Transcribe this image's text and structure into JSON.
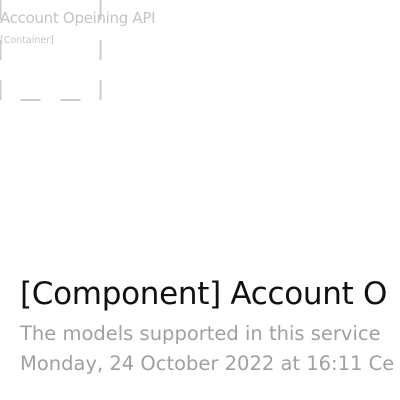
{
  "boundary": {
    "name": "Account Opeining API",
    "type": "[Container]",
    "border_color": "#cccccc"
  },
  "diagram": {
    "title": "[Component] Account O",
    "description": "The models supported in this service",
    "date": "Monday, 24 October 2022 at 16:11 Ce"
  }
}
